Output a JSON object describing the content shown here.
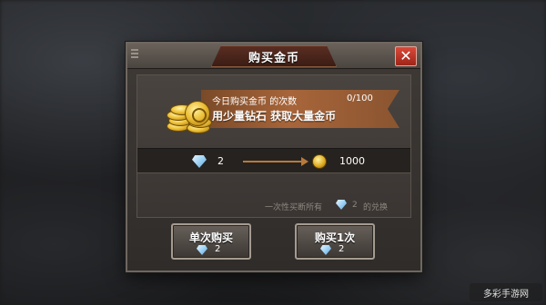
{
  "dialog": {
    "title": "购买金币",
    "close_label": "✕"
  },
  "banner": {
    "daily_label": "今日购买金币 的次数",
    "daily_count": "0/100",
    "slogan": "用少量钻石 获取大量金币"
  },
  "exchange": {
    "diamond_cost": "2",
    "coin_gain": "1000"
  },
  "hint": {
    "prefix": "一次性买断所有",
    "amount": "2",
    "suffix": "的兑换"
  },
  "buttons": {
    "single": {
      "label": "单次购买",
      "cost": "2"
    },
    "buy_once": {
      "label": "购买1次",
      "cost": "2"
    }
  },
  "watermark": {
    "text": "多彩手游网"
  },
  "colors": {
    "accent_ribbon": "#a8653a",
    "close_red": "#d94a3a",
    "diamond_blue": "#9fd3f5",
    "coin_gold": "#f0c33a"
  },
  "icons": [
    "coin-stack-icon",
    "diamond-icon",
    "arrow-right-icon",
    "gold-coin-icon",
    "close-icon",
    "grip-icon"
  ]
}
